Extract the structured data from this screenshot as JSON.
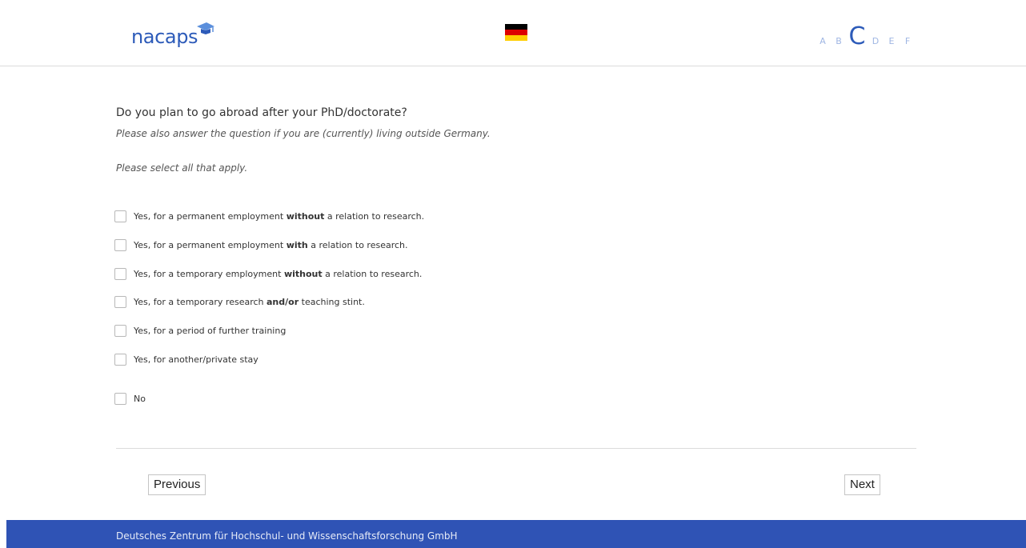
{
  "header": {
    "logo_text": "nacaps",
    "language_flag": "german-flag-icon",
    "steps": [
      {
        "label": "A",
        "active": false
      },
      {
        "label": "B",
        "active": false
      },
      {
        "label": "C",
        "active": true
      },
      {
        "label": "D",
        "active": false
      },
      {
        "label": "E",
        "active": false
      },
      {
        "label": "F",
        "active": false
      }
    ]
  },
  "question": {
    "title": "Do you plan to go abroad after your PhD/doctorate?",
    "hint": "Please also answer the question if you are (currently) living outside Germany.",
    "instruction": "Please select all that apply.",
    "options": [
      {
        "pre": "Yes, for a permanent employment ",
        "bold": "without",
        "post": " a relation to research.",
        "checked": false
      },
      {
        "pre": "Yes, for a permanent employment ",
        "bold": "with",
        "post": " a relation to research.",
        "checked": false
      },
      {
        "pre": "Yes, for a temporary employment ",
        "bold": "without",
        "post": " a relation to research.",
        "checked": false
      },
      {
        "pre": "Yes, for a temporary research ",
        "bold": "and/or",
        "post": " teaching stint.",
        "checked": false
      },
      {
        "pre": "Yes, for a period of further training",
        "bold": "",
        "post": "",
        "checked": false
      },
      {
        "pre": "Yes, for another/private stay",
        "bold": "",
        "post": "",
        "checked": false
      },
      {
        "pre": "No",
        "bold": "",
        "post": "",
        "checked": false
      }
    ]
  },
  "navigation": {
    "previous_label": "Previous",
    "next_label": "Next"
  },
  "footer": {
    "text": "Deutsches Zentrum für Hochschul- und Wissenschaftsforschung GmbH"
  },
  "colors": {
    "brand_blue": "#2d5bb9",
    "footer_blue": "#2f53b5",
    "step_inactive": "#9fb6e3"
  }
}
